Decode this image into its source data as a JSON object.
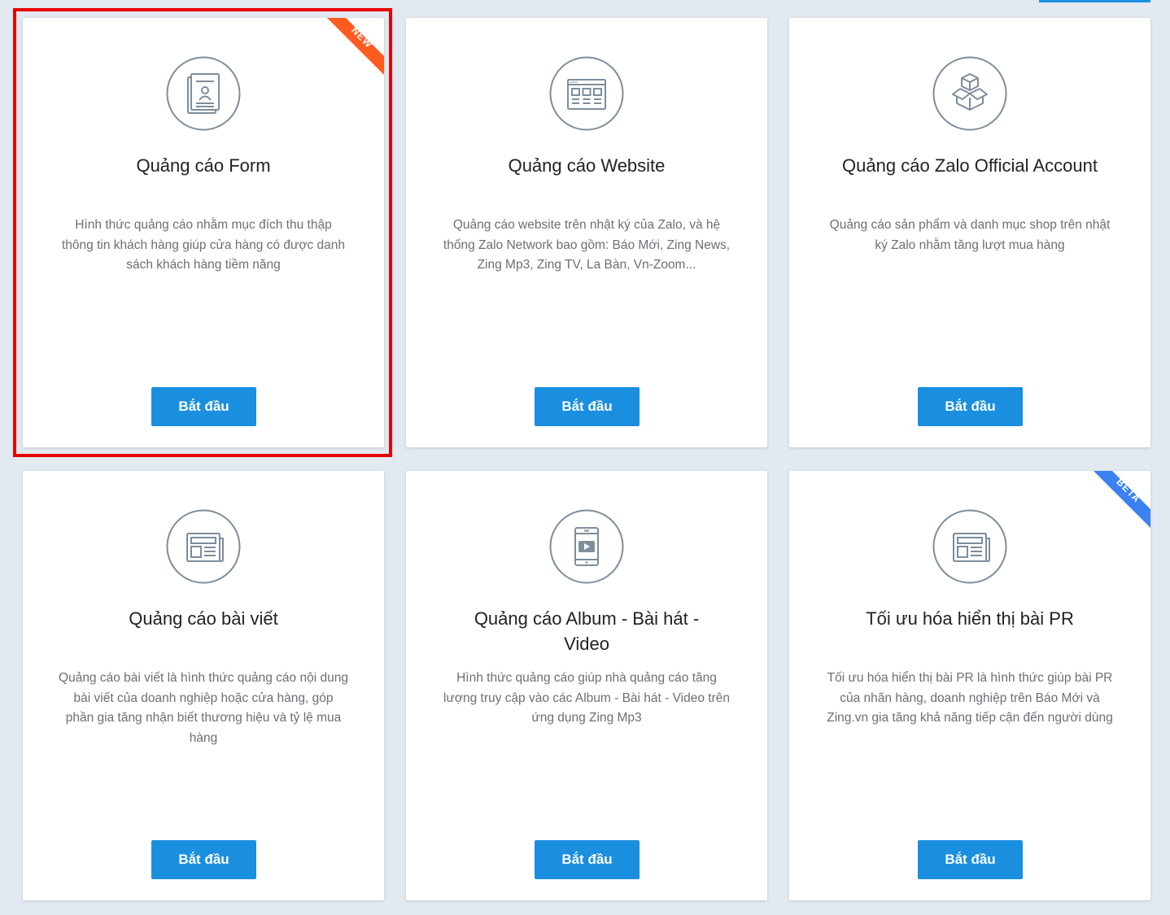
{
  "colors": {
    "accent": "#1a8fe0",
    "new_badge": "#ff5a1f",
    "beta_badge": "#3b82f0",
    "highlight": "#e80000",
    "icon_stroke": "#7d8d9c"
  },
  "cards": [
    {
      "icon": "lead-form-icon",
      "title": "Quảng cáo Form",
      "description": "Hình thức quảng cáo nhằm mục đích thu thập thông tin khách hàng giúp cửa hàng có được danh sách khách hàng tiềm năng",
      "button": "Bắt đầu",
      "badge": "NEW"
    },
    {
      "icon": "website-icon",
      "title": "Quảng cáo Website",
      "description": "Quảng cáo website trên nhật ký của Zalo, và hệ thống Zalo Network bao gồm: Báo Mới, Zing News, Zing Mp3, Zing TV, La Bàn, Vn-Zoom...",
      "button": "Bắt đầu"
    },
    {
      "icon": "product-box-icon",
      "title": "Quảng cáo Zalo Official Account",
      "description": "Quảng cáo sản phẩm và danh mục shop trên nhật ký Zalo nhằm tăng lượt mua hàng",
      "button": "Bắt đầu"
    },
    {
      "icon": "article-icon",
      "title": "Quảng cáo bài viết",
      "description": "Quảng cáo bài viết là hình thức quảng cáo nội dung bài viết của doanh nghiệp hoặc cửa hàng, góp phần gia tăng nhận biết thương hiệu và tỷ lệ mua hàng",
      "button": "Bắt đầu"
    },
    {
      "icon": "video-phone-icon",
      "title": "Quảng cáo Album - Bài hát - Video",
      "description": "Hình thức quảng cáo giúp nhà quảng cáo tăng lượng truy cập vào các Album - Bài hát - Video trên ứng dụng Zing Mp3",
      "button": "Bắt đầu"
    },
    {
      "icon": "pr-article-icon",
      "title": "Tối ưu hóa hiển thị bài PR",
      "description": "Tối ưu hóa hiển thị bài PR là hình thức giúp bài PR của nhãn hàng, doanh nghiệp trên Báo Mới và Zing.vn gia tăng khả năng tiếp cận đến người dùng",
      "button": "Bắt đầu",
      "badge": "BETA"
    }
  ]
}
